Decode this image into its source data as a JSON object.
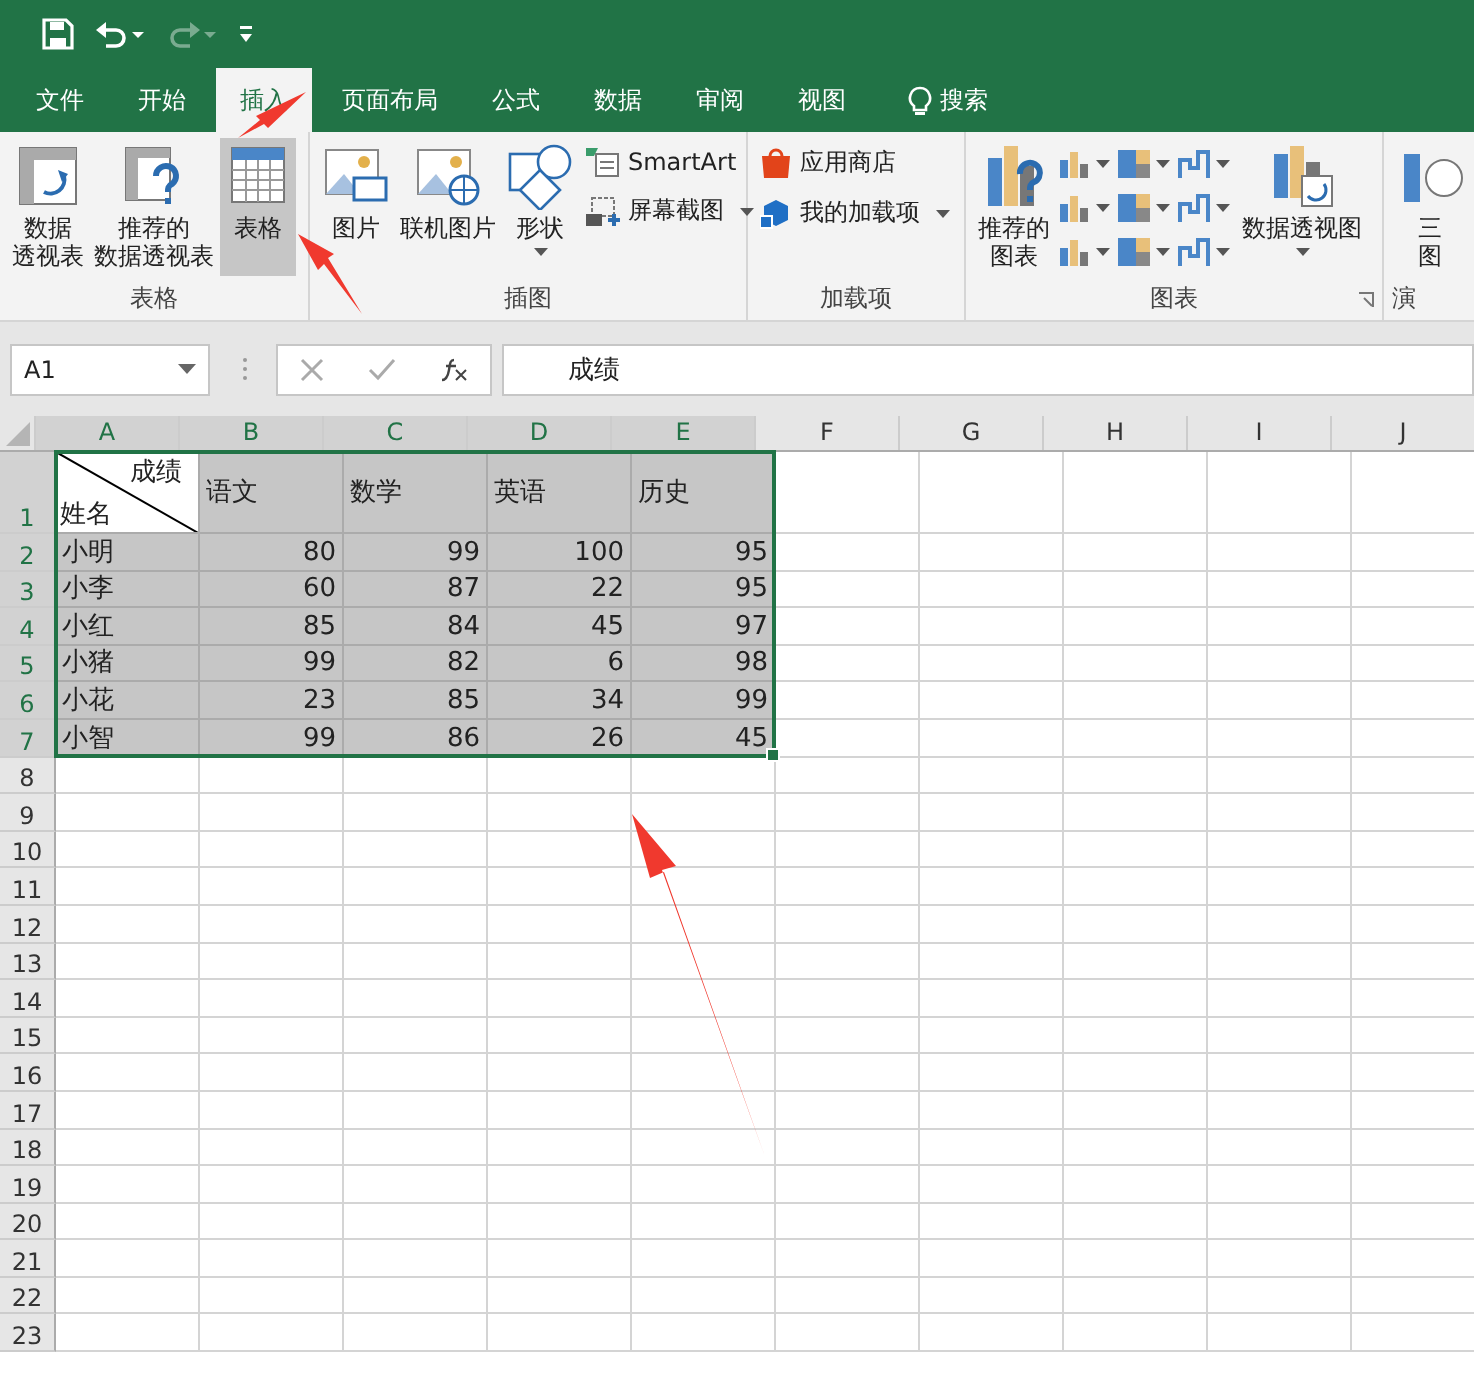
{
  "quick_access": {
    "redo": {
      "disabled": true
    }
  },
  "tabs": [
    {
      "label": "文件",
      "selected": false
    },
    {
      "label": "开始",
      "selected": false
    },
    {
      "label": "插入",
      "selected": true
    },
    {
      "label": "页面布局",
      "selected": false
    },
    {
      "label": "公式",
      "selected": false
    },
    {
      "label": "数据",
      "selected": false
    },
    {
      "label": "审阅",
      "selected": false
    },
    {
      "label": "视图",
      "selected": false
    }
  ],
  "search": {
    "label": "搜索"
  },
  "ribbon": [
    {
      "label": "表格",
      "buttons": [
        {
          "kind": "large",
          "lines": [
            "数据",
            "透视表"
          ],
          "selected": false
        },
        {
          "kind": "large",
          "lines": [
            "推荐的",
            "数据透视表"
          ],
          "selected": false
        },
        {
          "kind": "large",
          "lines": [
            "表格"
          ],
          "selected": true
        }
      ]
    },
    {
      "label": "插图",
      "buttons": [
        {
          "kind": "large",
          "lines": [
            "图片"
          ]
        },
        {
          "kind": "large",
          "lines": [
            "联机图片"
          ]
        },
        {
          "kind": "large",
          "lines": [
            "形状"
          ],
          "dropdown": true
        },
        {
          "kind": "stack",
          "items": [
            {
              "label": "SmartArt"
            },
            {
              "label": "屏幕截图",
              "dropdown": true
            }
          ]
        }
      ]
    },
    {
      "label": "加载项",
      "buttons": [
        {
          "kind": "stack",
          "items": [
            {
              "label": "应用商店"
            },
            {
              "label": "我的加载项",
              "dropdown": true
            }
          ]
        }
      ]
    },
    {
      "label": "图表",
      "launcher": true,
      "buttons": [
        {
          "kind": "large",
          "lines": [
            "推荐的",
            "图表"
          ]
        },
        {
          "kind": "chart-grid"
        },
        {
          "kind": "large",
          "lines": [
            "数据透视图"
          ],
          "dropdown": true
        }
      ]
    },
    {
      "label": "演",
      "buttons": [
        {
          "kind": "large",
          "lines": [
            "三",
            "图"
          ]
        }
      ]
    }
  ],
  "formula_bar": {
    "name_box": "A1",
    "formula": "成绩"
  },
  "columns": [
    {
      "label": "A",
      "selected": true
    },
    {
      "label": "B",
      "selected": true
    },
    {
      "label": "C",
      "selected": true
    },
    {
      "label": "D",
      "selected": true
    },
    {
      "label": "E",
      "selected": true
    },
    {
      "label": "F",
      "selected": false
    },
    {
      "label": "G",
      "selected": false
    },
    {
      "label": "H",
      "selected": false
    },
    {
      "label": "I",
      "selected": false
    },
    {
      "label": "J",
      "selected": false
    }
  ],
  "rows": [
    {
      "label": "1",
      "selected": true,
      "cells": [
        {
          "kind": "diagonal",
          "top": "成绩",
          "bottom": "姓名"
        },
        {
          "kind": "text",
          "text": "语文"
        },
        {
          "kind": "text",
          "text": "数学"
        },
        {
          "kind": "text",
          "text": "英语"
        },
        {
          "kind": "text",
          "text": "历史"
        }
      ]
    },
    {
      "label": "2",
      "selected": true,
      "cells": [
        {
          "kind": "text",
          "text": "小明"
        },
        {
          "kind": "number",
          "text": "80"
        },
        {
          "kind": "number",
          "text": "99"
        },
        {
          "kind": "number",
          "text": "100"
        },
        {
          "kind": "number",
          "text": "95"
        }
      ]
    },
    {
      "label": "3",
      "selected": true,
      "cells": [
        {
          "kind": "text",
          "text": "小李"
        },
        {
          "kind": "number",
          "text": "60"
        },
        {
          "kind": "number",
          "text": "87"
        },
        {
          "kind": "number",
          "text": "22"
        },
        {
          "kind": "number",
          "text": "95"
        }
      ]
    },
    {
      "label": "4",
      "selected": true,
      "cells": [
        {
          "kind": "text",
          "text": "小红"
        },
        {
          "kind": "number",
          "text": "85"
        },
        {
          "kind": "number",
          "text": "84"
        },
        {
          "kind": "number",
          "text": "45"
        },
        {
          "kind": "number",
          "text": "97"
        }
      ]
    },
    {
      "label": "5",
      "selected": true,
      "cells": [
        {
          "kind": "text",
          "text": "小猪"
        },
        {
          "kind": "number",
          "text": "99"
        },
        {
          "kind": "number",
          "text": "82"
        },
        {
          "kind": "number",
          "text": "6"
        },
        {
          "kind": "number",
          "text": "98"
        }
      ]
    },
    {
      "label": "6",
      "selected": true,
      "cells": [
        {
          "kind": "text",
          "text": "小花"
        },
        {
          "kind": "number",
          "text": "23"
        },
        {
          "kind": "number",
          "text": "85"
        },
        {
          "kind": "number",
          "text": "34"
        },
        {
          "kind": "number",
          "text": "99"
        }
      ]
    },
    {
      "label": "7",
      "selected": true,
      "cells": [
        {
          "kind": "text",
          "text": "小智"
        },
        {
          "kind": "number",
          "text": "99"
        },
        {
          "kind": "number",
          "text": "86"
        },
        {
          "kind": "number",
          "text": "26"
        },
        {
          "kind": "number",
          "text": "45"
        }
      ]
    },
    {
      "label": "8",
      "selected": false
    },
    {
      "label": "9",
      "selected": false
    },
    {
      "label": "10",
      "selected": false
    },
    {
      "label": "11",
      "selected": false
    },
    {
      "label": "12",
      "selected": false
    },
    {
      "label": "13",
      "selected": false
    },
    {
      "label": "14",
      "selected": false
    },
    {
      "label": "15",
      "selected": false
    },
    {
      "label": "16",
      "selected": false
    },
    {
      "label": "17",
      "selected": false
    },
    {
      "label": "18",
      "selected": false
    },
    {
      "label": "19",
      "selected": false
    },
    {
      "label": "20",
      "selected": false
    },
    {
      "label": "21",
      "selected": false
    },
    {
      "label": "22",
      "selected": false
    },
    {
      "label": "23",
      "selected": false
    }
  ]
}
